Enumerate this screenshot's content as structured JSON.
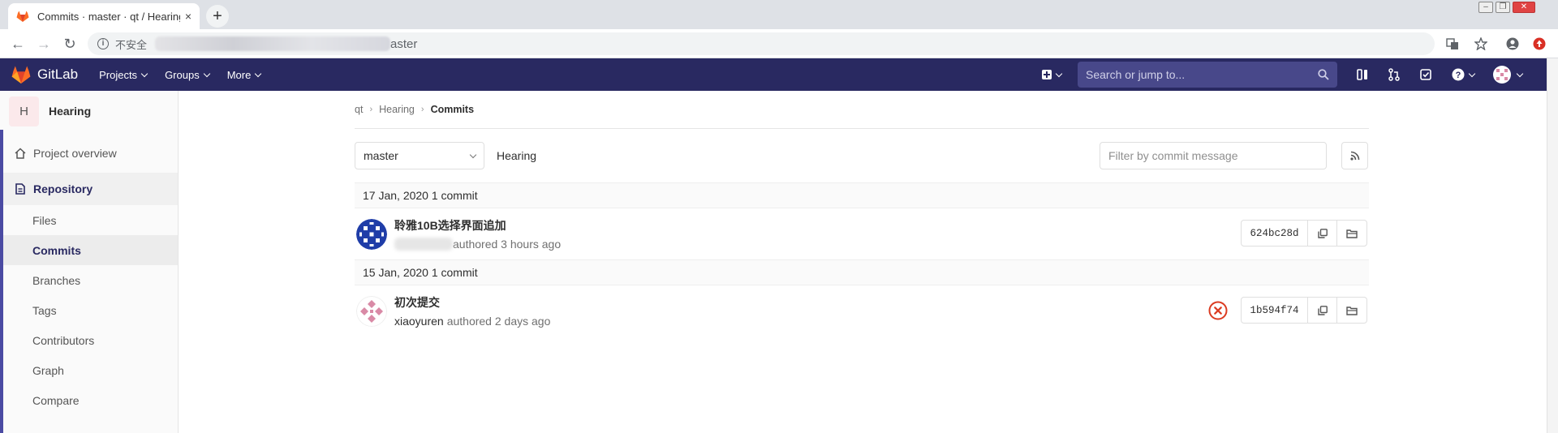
{
  "browser": {
    "tab_title": "Commits · master · qt / Hearing",
    "tab_close": "×",
    "new_tab": "+",
    "insecure_label": "不安全",
    "url_tail": "aster"
  },
  "header": {
    "brand": "GitLab",
    "nav": [
      "Projects",
      "Groups",
      "More"
    ],
    "search_placeholder": "Search or jump to..."
  },
  "sidebar": {
    "project_initial": "H",
    "project_name": "Hearing",
    "overview": "Project overview",
    "repository": "Repository",
    "sub_items": [
      "Files",
      "Commits",
      "Branches",
      "Tags",
      "Contributors",
      "Graph",
      "Compare"
    ]
  },
  "breadcrumb": [
    "qt",
    "Hearing",
    "Commits"
  ],
  "toolbar": {
    "branch": "master",
    "project_label": "Hearing",
    "filter_placeholder": "Filter by commit message"
  },
  "commit_groups": [
    {
      "date": "17 Jan, 2020 1 commit",
      "commits": [
        {
          "title": "聆雅10B选择界面追加",
          "author": "",
          "meta": "authored 3 hours ago",
          "sha": "624bc28d",
          "status": ""
        }
      ]
    },
    {
      "date": "15 Jan, 2020 1 commit",
      "commits": [
        {
          "title": "初次提交",
          "author": "xiaoyuren",
          "meta": "authored 2 days ago",
          "sha": "1b594f74",
          "status": "failed"
        }
      ]
    }
  ],
  "colors": {
    "header_bg": "#292961",
    "accent": "#4b4ba3",
    "status_failed": "#db3b21",
    "logo_orange": "#fc6d26"
  }
}
